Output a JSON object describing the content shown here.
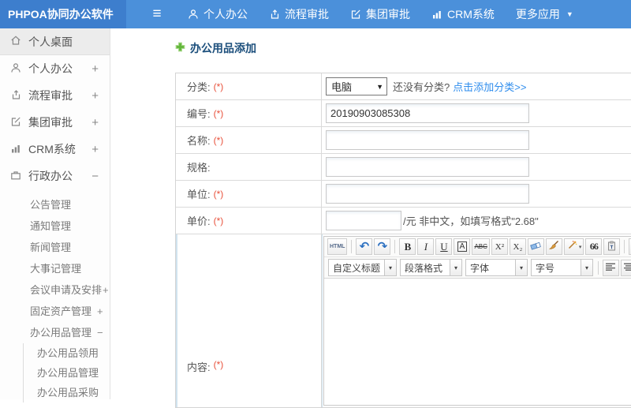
{
  "topbar": {
    "logo": "PHPOA协同办公软件",
    "menu_icon_name": "hamburger-menu-icon",
    "nav": [
      {
        "label": "个人办公",
        "icon": "user-icon"
      },
      {
        "label": "流程审批",
        "icon": "workflow-icon"
      },
      {
        "label": "集团审批",
        "icon": "edit-square-icon"
      },
      {
        "label": "CRM系统",
        "icon": "bar-chart-icon"
      },
      {
        "label": "更多应用",
        "icon": "caret-down-icon"
      }
    ]
  },
  "sidebar": {
    "items": [
      {
        "label": "个人桌面",
        "icon": "home-icon",
        "toggle": ""
      },
      {
        "label": "个人办公",
        "icon": "user-icon",
        "toggle": "+"
      },
      {
        "label": "流程审批",
        "icon": "workflow-icon",
        "toggle": "+"
      },
      {
        "label": "集团审批",
        "icon": "edit-square-icon",
        "toggle": "+"
      },
      {
        "label": "CRM系统",
        "icon": "bar-chart-icon",
        "toggle": "+"
      },
      {
        "label": "行政办公",
        "icon": "briefcase-icon",
        "toggle": "−"
      }
    ],
    "admin_menu": [
      {
        "label": "公告管理",
        "toggle": ""
      },
      {
        "label": "通知管理",
        "toggle": ""
      },
      {
        "label": "新闻管理",
        "toggle": ""
      },
      {
        "label": "大事记管理",
        "toggle": ""
      },
      {
        "label": "会议申请及安排",
        "toggle": "+"
      },
      {
        "label": "固定资产管理",
        "toggle": "+"
      },
      {
        "label": "办公用品管理",
        "toggle": "−"
      }
    ],
    "supplies_menu": [
      {
        "label": "办公用品领用"
      },
      {
        "label": "办公用品管理"
      },
      {
        "label": "办公用品采购"
      }
    ]
  },
  "main": {
    "title": "办公用品添加",
    "form": {
      "category_label": "分类:",
      "category_req": "(*)",
      "category_value": "电脑",
      "category_caret": "▼",
      "category_hint": "还没有分类?",
      "category_link": "点击添加分类>>",
      "code_label": "编号:",
      "code_req": "(*)",
      "code_value": "20190903085308",
      "name_label": "名称:",
      "name_req": "(*)",
      "spec_label": "规格:",
      "unit_label": "单位:",
      "unit_req": "(*)",
      "price_label": "单价:",
      "price_req": "(*)",
      "price_hint": "/元 非中文，如填写格式\"2.68\"",
      "content_label": "内容:",
      "content_req": "(*)"
    },
    "editor": {
      "btn_html": "HTML",
      "btn_undo": "↶",
      "btn_redo": "↷",
      "btn_bold": "B",
      "btn_italic": "I",
      "btn_underline": "U",
      "btn_fontbox": "A",
      "btn_strike": "ABC",
      "btn_sup": "X²",
      "btn_sub": "X₂",
      "btn_quote": "66",
      "btn_fontcolor": "A",
      "btn_highlight": "ab",
      "selects": [
        {
          "value": "自定义标题"
        },
        {
          "value": "段落格式"
        },
        {
          "value": "字体"
        },
        {
          "value": "字号"
        }
      ]
    }
  },
  "colors": {
    "topbar_bg": "#4b90da",
    "logo_bg": "#3d7ecd",
    "accent_green": "#62b63a",
    "link_blue": "#2f8ded",
    "required_red": "#e8503a",
    "title_navy": "#1c4f7c"
  }
}
